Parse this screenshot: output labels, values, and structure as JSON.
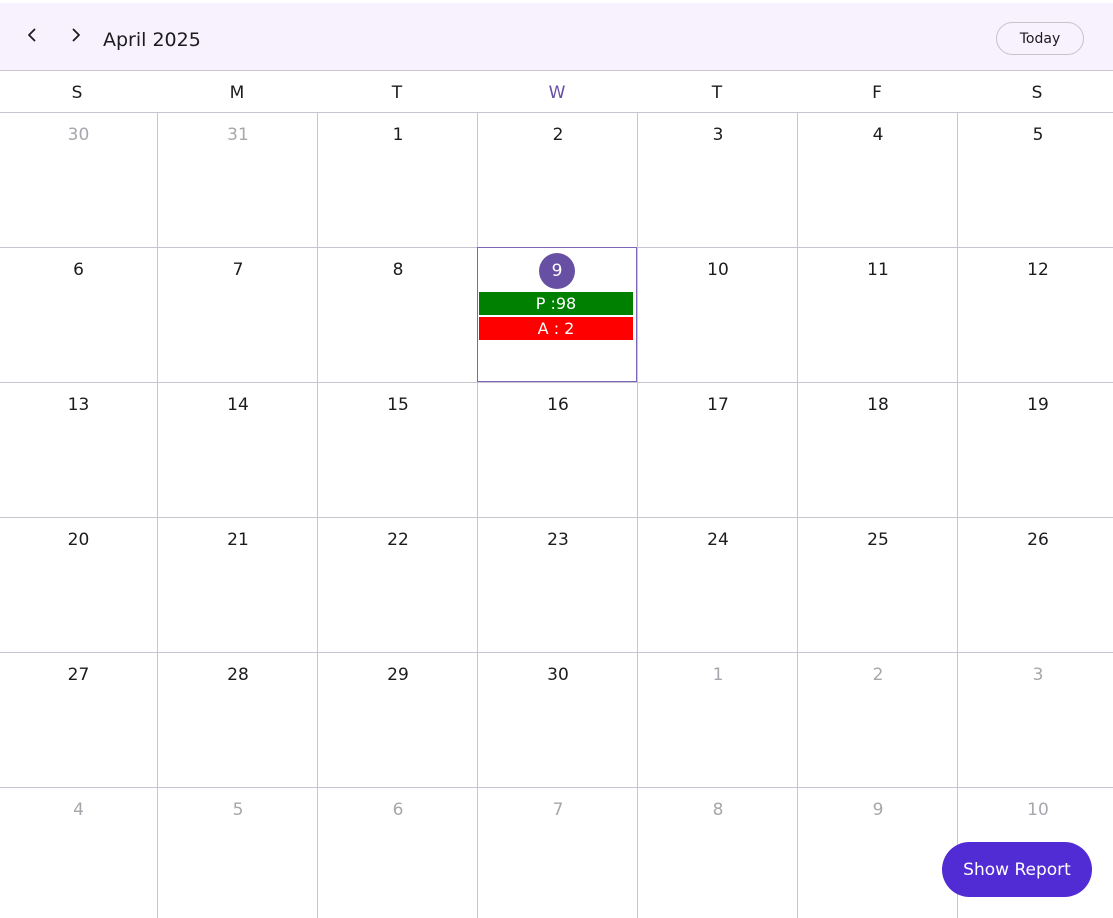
{
  "header": {
    "title": "April 2025",
    "today_label": "Today",
    "prev_icon": "chevron-left-icon",
    "next_icon": "chevron-right-icon",
    "background": "#f7f2fd"
  },
  "weekdays": [
    "S",
    "M",
    "T",
    "W",
    "T",
    "F",
    "S"
  ],
  "current_weekday_index": 3,
  "weeks": [
    [
      {
        "d": "30",
        "other": true
      },
      {
        "d": "31",
        "other": true
      },
      {
        "d": "1"
      },
      {
        "d": "2"
      },
      {
        "d": "3"
      },
      {
        "d": "4"
      },
      {
        "d": "5"
      }
    ],
    [
      {
        "d": "6"
      },
      {
        "d": "7"
      },
      {
        "d": "8"
      },
      {
        "d": "9",
        "today": true,
        "appointments": [
          {
            "label": "P :98",
            "kind": "present"
          },
          {
            "label": "A : 2",
            "kind": "absent"
          }
        ]
      },
      {
        "d": "10"
      },
      {
        "d": "11"
      },
      {
        "d": "12"
      }
    ],
    [
      {
        "d": "13"
      },
      {
        "d": "14"
      },
      {
        "d": "15"
      },
      {
        "d": "16"
      },
      {
        "d": "17"
      },
      {
        "d": "18"
      },
      {
        "d": "19"
      }
    ],
    [
      {
        "d": "20"
      },
      {
        "d": "21"
      },
      {
        "d": "22"
      },
      {
        "d": "23"
      },
      {
        "d": "24"
      },
      {
        "d": "25"
      },
      {
        "d": "26"
      }
    ],
    [
      {
        "d": "27"
      },
      {
        "d": "28"
      },
      {
        "d": "29"
      },
      {
        "d": "30"
      },
      {
        "d": "1",
        "other": true
      },
      {
        "d": "2",
        "other": true
      },
      {
        "d": "3",
        "other": true
      }
    ],
    [
      {
        "d": "4",
        "other": true
      },
      {
        "d": "5",
        "other": true
      },
      {
        "d": "6",
        "other": true
      },
      {
        "d": "7",
        "other": true
      },
      {
        "d": "8",
        "other": true
      },
      {
        "d": "9",
        "other": true
      },
      {
        "d": "10",
        "other": true
      }
    ]
  ],
  "colors": {
    "accent": "#6750a4",
    "present": "#008000",
    "absent": "#ff0000",
    "report_button": "#512bd4"
  },
  "report_button_label": "Show Report"
}
